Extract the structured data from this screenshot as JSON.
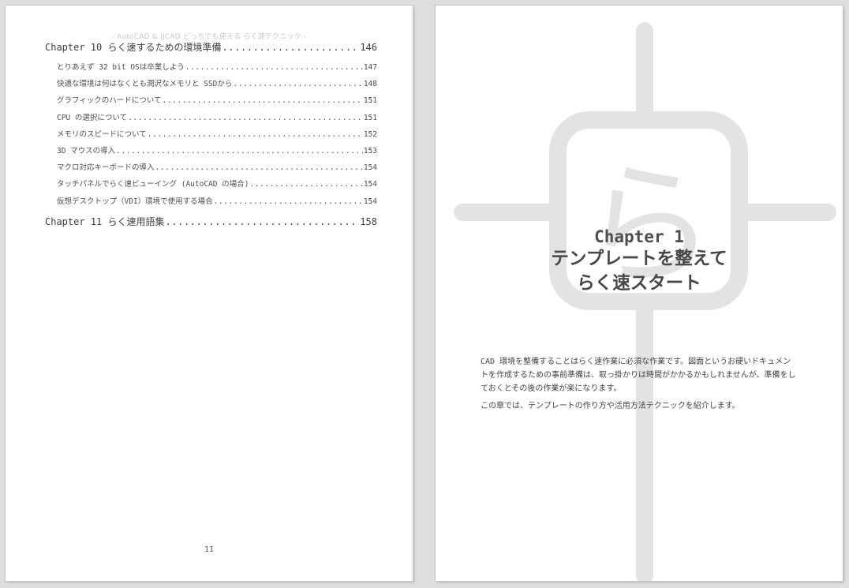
{
  "left_page": {
    "running_header": "- AutoCAD & IJCAD どっちでも使える らく速テクニック -",
    "toc": [
      {
        "level": "chapter",
        "title": "Chapter 10 らく速するための環境準備",
        "page": "146"
      },
      {
        "level": "section",
        "title": "とりあえず 32 bit OSは卒業しよう",
        "page": "147"
      },
      {
        "level": "section",
        "title": "快適な環境は何はなくとも潤沢なメモリと SSDから",
        "page": "148"
      },
      {
        "level": "section",
        "title": "グラフィックのハードについて",
        "page": "151"
      },
      {
        "level": "section",
        "title": "CPU の選択について",
        "page": "151"
      },
      {
        "level": "section",
        "title": "メモリのスピードについて",
        "page": "152"
      },
      {
        "level": "section",
        "title": "3D マウスの導入",
        "page": "153"
      },
      {
        "level": "section",
        "title": "マクロ対応キーボードの導入",
        "page": "154"
      },
      {
        "level": "section",
        "title": "タッチパネルでらく速ビューイング (AutoCAD の場合)",
        "page": "154"
      },
      {
        "level": "section",
        "title": "仮想デスクトップ（VDI）環境で使用する場合",
        "page": "154"
      },
      {
        "level": "chapter",
        "title": "Chapter 11 らく速用語集",
        "page": "158"
      }
    ],
    "page_number": "11"
  },
  "right_page": {
    "background_glyph": "ら",
    "chapter_label": "Chapter 1",
    "chapter_title_lines": [
      "テンプレートを整えて",
      "らく速スタート"
    ],
    "intro_paragraphs": [
      "CAD 環境を整備することはらく速作業に必須な作業です。図面というお硬いドキュメントを作成するための事前準備は、取っ掛かりは時間がかかるかもしれませんが、準備をしておくとその後の作業が楽になります。",
      "この章では、テンプレートの作り方や活用方法テクニックを紹介します。"
    ]
  },
  "colors": {
    "background": "#dedede",
    "page": "#ffffff",
    "watermark": "#e3e3e3",
    "text": "#444444"
  }
}
